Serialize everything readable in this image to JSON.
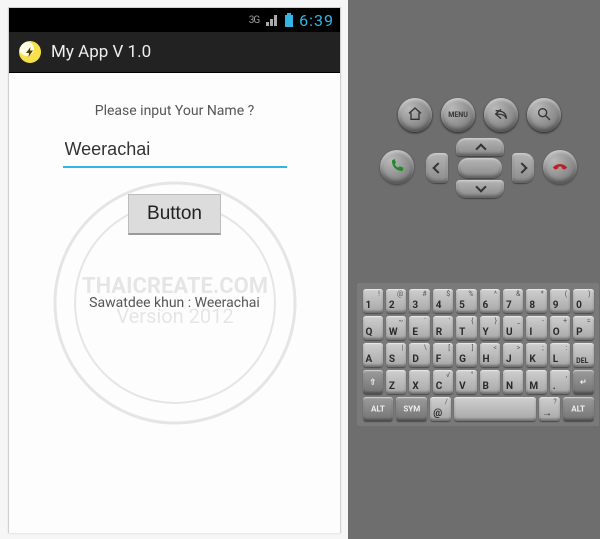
{
  "statusbar": {
    "network": "3G",
    "clock": "6:39"
  },
  "app": {
    "title": "My App V 1.0"
  },
  "screen": {
    "prompt": "Please input Your Name ?",
    "name_value": "Weerachai",
    "button_label": "Button",
    "result": "Sawatdee khun : Weerachai"
  },
  "hw": {
    "menu_label": "MENU"
  },
  "keyboard": {
    "row1": [
      {
        "m": "1",
        "a": "!"
      },
      {
        "m": "2",
        "a": "@"
      },
      {
        "m": "3",
        "a": "#"
      },
      {
        "m": "4",
        "a": "$"
      },
      {
        "m": "5",
        "a": "%"
      },
      {
        "m": "6",
        "a": "^"
      },
      {
        "m": "7",
        "a": "&"
      },
      {
        "m": "8",
        "a": "*"
      },
      {
        "m": "9",
        "a": "("
      },
      {
        "m": "0",
        "a": ")"
      }
    ],
    "row2": [
      {
        "m": "Q"
      },
      {
        "m": "W",
        "a": "~"
      },
      {
        "m": "E",
        "a": "¨"
      },
      {
        "m": "R",
        "a": "'"
      },
      {
        "m": "T",
        "a": "{"
      },
      {
        "m": "Y",
        "a": "}"
      },
      {
        "m": "U",
        "a": "_"
      },
      {
        "m": "I",
        "a": "-"
      },
      {
        "m": "O",
        "a": "+"
      },
      {
        "m": "P",
        "a": "="
      }
    ],
    "row3": [
      {
        "m": "A"
      },
      {
        "m": "S",
        "a": "|"
      },
      {
        "m": "D",
        "a": "\\"
      },
      {
        "m": "F",
        "a": "["
      },
      {
        "m": "G",
        "a": "]"
      },
      {
        "m": "H",
        "a": "<"
      },
      {
        "m": "J",
        "a": ">"
      },
      {
        "m": "K",
        "a": ";"
      },
      {
        "m": "L",
        "a": ":"
      },
      {
        "m": "DEL",
        "del": true
      }
    ],
    "row4_mid": [
      {
        "m": "Z"
      },
      {
        "m": "X"
      },
      {
        "m": "C",
        "a": "√"
      },
      {
        "m": "V",
        "a": "°"
      },
      {
        "m": "B"
      },
      {
        "m": "N"
      },
      {
        "m": "M"
      },
      {
        "m": ".",
        "a": ","
      },
      {
        "m": "↵",
        "enter": true
      }
    ],
    "row5_mid": [
      {
        "m": "@",
        "a": "/"
      },
      {
        "m": "",
        "space": true
      },
      {
        "m": "→",
        "a": "?"
      }
    ],
    "shift": "⇧",
    "alt": "ALT",
    "sym": "SYM"
  }
}
